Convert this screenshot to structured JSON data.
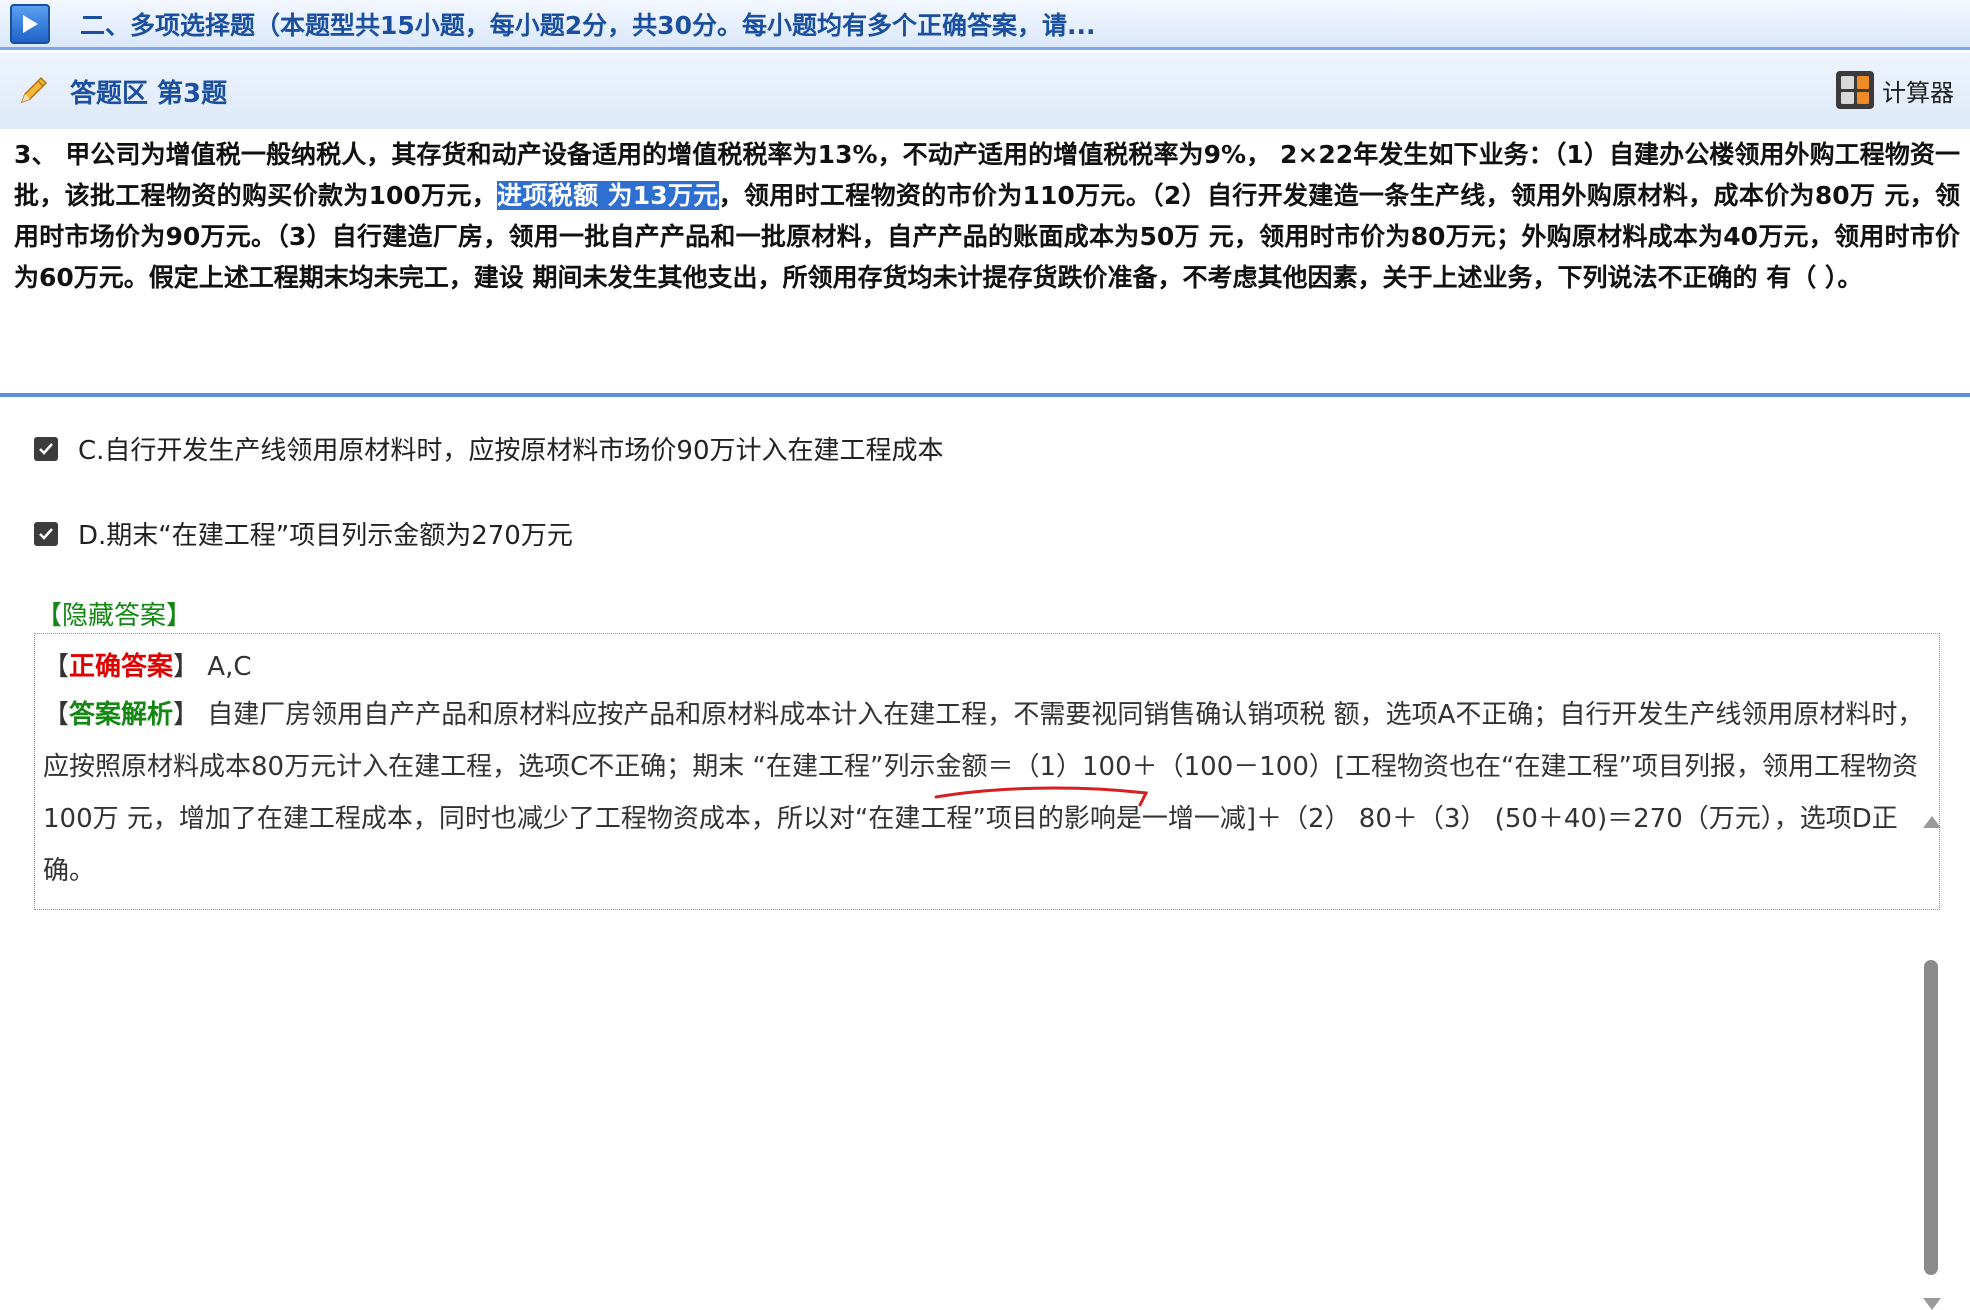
{
  "section": {
    "title": "二、多项选择题（本题型共15小题，每小题2分，共30分。每小题均有多个正确答案，请..."
  },
  "answer_area": {
    "title": "答题区 第3题",
    "calculator_label": "计算器"
  },
  "question": {
    "part1": "3、 甲公司为增值税一般纳税人，其存货和动产设备适用的增值税税率为13%，不动产适用的增值税税率为9%， 2×22年发生如下业务：（1）自建办公楼领用外购工程物资一批，该批工程物资的购买价款为100万元，",
    "highlight": "进项税额 为13万元",
    "part2": "，领用时工程物资的市价为110万元。（2）自行开发建造一条生产线，领用外购原材料，成本价为80万 元，领用时市场价为90万元。（3）自行建造厂房，领用一批自产产品和一批原材料，自产产品的账面成本为50万 元，领用时市价为80万元；外购原材料成本为40万元，领用时市价为60万元。假定上述工程期末均未完工，建设 期间未发生其他支出，所领用存货均未计提存货跌价准备，不考虑其他因素，关于上述业务，下列说法不正确的 有（ ）。"
  },
  "options": [
    {
      "label": "C.自行开发生产线领用原材料时，应按原材料市场价90万计入在建工程成本",
      "checked": true
    },
    {
      "label": "D.期末“在建工程”项目列示金额为270万元",
      "checked": true
    }
  ],
  "hidden_answer_label": "【隐藏答案】",
  "correct_answer": {
    "bracket_open": "【",
    "label": "正确答案",
    "bracket_close": "】",
    "value": " A,C"
  },
  "explanation": {
    "bracket_open": "【",
    "label": "答案解析",
    "bracket_close": "】",
    "text": " 自建厂房领用自产产品和原材料应按产品和原材料成本计入在建工程，不需要视同销售确认销项税 额，选项A不正确；自行开发生产线领用原材料时，应按照原材料成本80万元计入在建工程，选项C不正确；期末 “在建工程”列示金额＝（1）100＋（100－100）[工程物资也在“在建工程”项目列报，领用工程物资100万 元，增加了在建工程成本，同时也减少了工程物资成本，所以对“在建工程”项目的影响是一增一减]＋（2） 80＋（3） (50＋40)＝270（万元），选项D正确。"
  },
  "colors": {
    "accent": "#1b4f9f",
    "highlight": "#2f6fd1",
    "answer_red": "#e00000",
    "answer_green": "#128812",
    "box_border": "#e07a20"
  }
}
